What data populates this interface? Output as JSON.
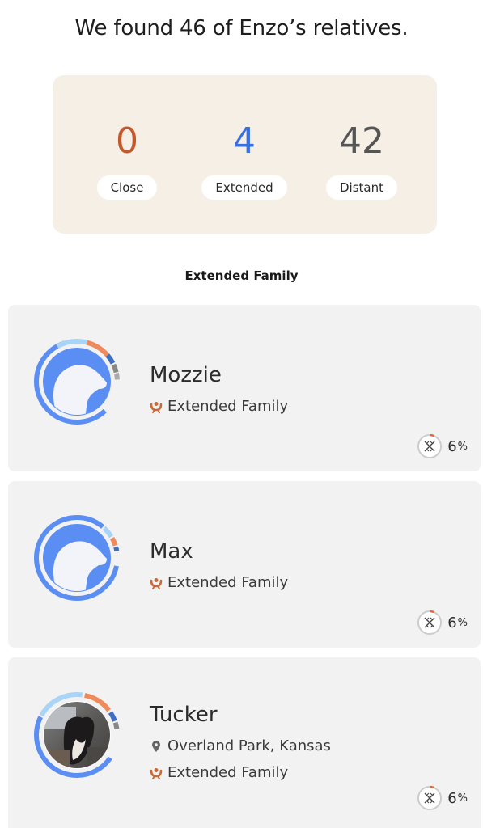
{
  "header": {
    "title": "We found 46 of Enzo’s relatives."
  },
  "summary": {
    "stats": [
      {
        "value": "0",
        "label": "Close",
        "color": "#c05a2e"
      },
      {
        "value": "4",
        "label": "Extended",
        "color": "#3a6fe0"
      },
      {
        "value": "42",
        "label": "Distant",
        "color": "#555555"
      }
    ]
  },
  "section": {
    "title": "Extended Family"
  },
  "relatives": [
    {
      "name": "Mozzie",
      "relationship": "Extended Family",
      "dna_value": "6",
      "dna_unit": "%",
      "avatar": "dog-silhouette-icon"
    },
    {
      "name": "Max",
      "relationship": "Extended Family",
      "dna_value": "6",
      "dna_unit": "%",
      "avatar": "dog-silhouette-icon"
    },
    {
      "name": "Tucker",
      "location": "Overland Park, Kansas",
      "relationship": "Extended Family",
      "dna_value": "6",
      "dna_unit": "%",
      "avatar": "dog-photo"
    }
  ],
  "colors": {
    "accent_orange": "#c86a38",
    "accent_blue": "#4c86f0",
    "card_bg": "#f2f2f2",
    "summary_bg": "#f6efe6"
  }
}
